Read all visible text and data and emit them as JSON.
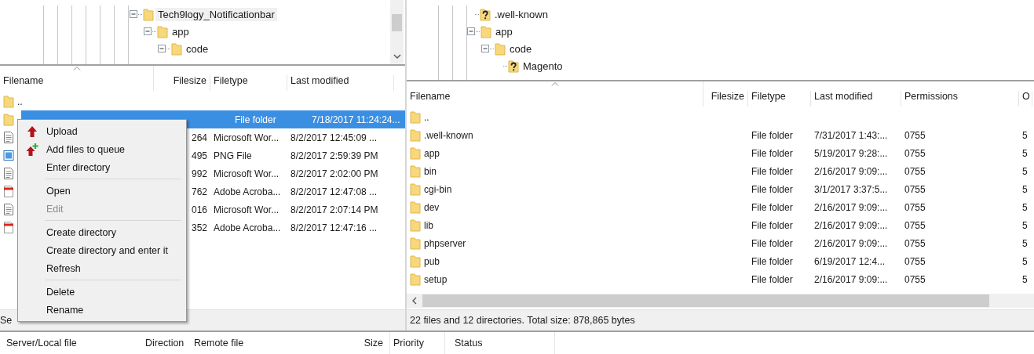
{
  "local": {
    "tree": [
      {
        "name": "Tech9logy_Notificationbar",
        "kind": "folder",
        "expanded": true,
        "selected": true,
        "children": [
          {
            "name": "app",
            "kind": "folder",
            "expanded": true,
            "selected": false,
            "children": [
              {
                "name": "code",
                "kind": "folder",
                "expanded": true,
                "selected": false
              }
            ]
          }
        ]
      }
    ],
    "columns": [
      {
        "label": "Filename",
        "sorted": true
      },
      {
        "label": "Filesize",
        "sorted": false
      },
      {
        "label": "Filetype",
        "sorted": false
      },
      {
        "label": "Last modified",
        "sorted": false
      }
    ],
    "rows": [
      {
        "kind": "folder",
        "name": "..",
        "selected": false
      },
      {
        "kind": "folder",
        "type": "File folder",
        "modified": "7/18/2017 11:24:24...",
        "selected": true
      },
      {
        "kind": "word",
        "size": "264",
        "type": "Microsoft Wor...",
        "modified": "8/2/2017 12:45:09 ...",
        "selected": false
      },
      {
        "kind": "image",
        "size": "495",
        "type": "PNG File",
        "modified": "8/2/2017 2:59:39 PM",
        "selected": false
      },
      {
        "kind": "word",
        "size": "992",
        "type": "Microsoft Wor...",
        "modified": "8/2/2017 2:02:00 PM",
        "selected": false
      },
      {
        "kind": "pdf",
        "size": "762",
        "type": "Adobe Acroba...",
        "modified": "8/2/2017 12:47:08 ...",
        "selected": false
      },
      {
        "kind": "word",
        "size": "016",
        "type": "Microsoft Wor...",
        "modified": "8/2/2017 2:07:14 PM",
        "selected": false
      },
      {
        "kind": "pdf",
        "size": "352",
        "type": "Adobe Acroba...",
        "modified": "8/2/2017 12:47:16 ...",
        "selected": false
      }
    ],
    "status": "Se"
  },
  "remote": {
    "tree": [
      {
        "name": ".well-known",
        "kind": "unknown",
        "selected": false
      },
      {
        "name": "app",
        "kind": "folder",
        "expanded": true,
        "selected": false,
        "children": [
          {
            "name": "code",
            "kind": "folder",
            "expanded": true,
            "selected": false,
            "children": [
              {
                "name": "Magento",
                "kind": "unknown",
                "selected": false
              }
            ]
          }
        ]
      }
    ],
    "columns": [
      {
        "label": "Filename",
        "sorted": true
      },
      {
        "label": "Filesize",
        "sorted": false
      },
      {
        "label": "Filetype",
        "sorted": false
      },
      {
        "label": "Last modified",
        "sorted": false
      },
      {
        "label": "Permissions",
        "sorted": false
      },
      {
        "label": "O",
        "sorted": false
      }
    ],
    "rows": [
      {
        "kind": "folder",
        "name": "..",
        "selected": false
      },
      {
        "kind": "folder",
        "name": ".well-known",
        "type": "File folder",
        "modified": "7/31/2017 1:43:...",
        "permissions": "0755",
        "owner": "5",
        "selected": false
      },
      {
        "kind": "folder",
        "name": "app",
        "type": "File folder",
        "modified": "5/19/2017 9:28:...",
        "permissions": "0755",
        "owner": "5",
        "selected": false
      },
      {
        "kind": "folder",
        "name": "bin",
        "type": "File folder",
        "modified": "2/16/2017 9:09:...",
        "permissions": "0755",
        "owner": "5",
        "selected": false
      },
      {
        "kind": "folder",
        "name": "cgi-bin",
        "type": "File folder",
        "modified": "3/1/2017 3:37:5...",
        "permissions": "0755",
        "owner": "5",
        "selected": false
      },
      {
        "kind": "folder",
        "name": "dev",
        "type": "File folder",
        "modified": "2/16/2017 9:09:...",
        "permissions": "0755",
        "owner": "5",
        "selected": false
      },
      {
        "kind": "folder",
        "name": "lib",
        "type": "File folder",
        "modified": "2/16/2017 9:09:...",
        "permissions": "0755",
        "owner": "5",
        "selected": false
      },
      {
        "kind": "folder",
        "name": "phpserver",
        "type": "File folder",
        "modified": "2/16/2017 9:09:...",
        "permissions": "0755",
        "owner": "5",
        "selected": false
      },
      {
        "kind": "folder",
        "name": "pub",
        "type": "File folder",
        "modified": "6/19/2017 12:4...",
        "permissions": "0755",
        "owner": "5",
        "selected": false
      },
      {
        "kind": "folder",
        "name": "setup",
        "type": "File folder",
        "modified": "2/16/2017 9:09:...",
        "permissions": "0755",
        "owner": "5",
        "selected": false
      }
    ],
    "status": "22 files and 12 directories. Total size: 878,865 bytes"
  },
  "queue": {
    "columns": [
      "Server/Local file",
      "Direction",
      "Remote file",
      "Size",
      "Priority",
      "Status"
    ]
  },
  "context_menu": {
    "items": [
      {
        "kind": "upload",
        "label": "Upload",
        "disabled": false
      },
      {
        "kind": "add-to-queue",
        "label": "Add files to queue",
        "disabled": false
      },
      {
        "kind": "item",
        "label": "Enter directory",
        "disabled": false
      },
      {
        "kind": "separator"
      },
      {
        "kind": "item",
        "label": "Open",
        "disabled": false
      },
      {
        "kind": "item",
        "label": "Edit",
        "disabled": true
      },
      {
        "kind": "separator"
      },
      {
        "kind": "item",
        "label": "Create directory",
        "disabled": false
      },
      {
        "kind": "item",
        "label": "Create directory and enter it",
        "disabled": false
      },
      {
        "kind": "item",
        "label": "Refresh",
        "disabled": false
      },
      {
        "kind": "separator"
      },
      {
        "kind": "item",
        "label": "Delete",
        "disabled": false
      },
      {
        "kind": "item",
        "label": "Rename",
        "disabled": false
      }
    ]
  }
}
